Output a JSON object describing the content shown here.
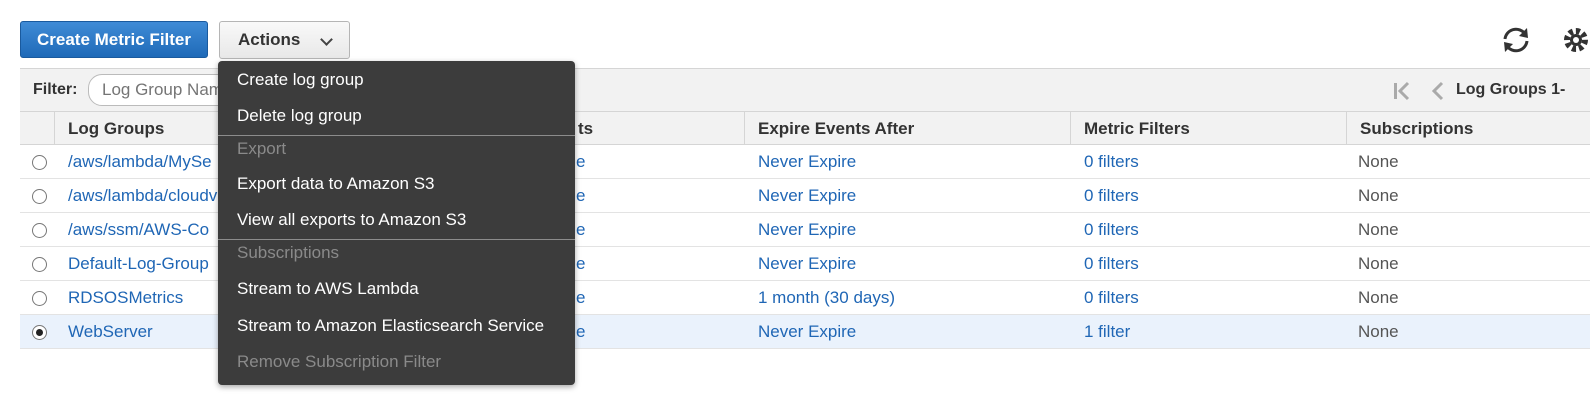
{
  "toolbar": {
    "create_label": "Create Metric Filter",
    "actions_label": "Actions"
  },
  "filter": {
    "label": "Filter:",
    "placeholder": "Log Group Name Prefix",
    "pager_label": "Log Groups 1-"
  },
  "table": {
    "headers": {
      "log_groups": "Log Groups",
      "insights": "ts",
      "expire": "Expire Events After",
      "metric_filters": "Metric Filters",
      "subscriptions": "Subscriptions"
    },
    "rows": [
      {
        "name": "/aws/lambda/MySe",
        "insights": "e",
        "expire": "Never Expire",
        "filters": "0 filters",
        "subscriptions": "None",
        "selected": false
      },
      {
        "name": "/aws/lambda/cloudv",
        "insights": "e",
        "expire": "Never Expire",
        "filters": "0 filters",
        "subscriptions": "None",
        "selected": false
      },
      {
        "name": "/aws/ssm/AWS-Co",
        "insights": "e",
        "expire": "Never Expire",
        "filters": "0 filters",
        "subscriptions": "None",
        "selected": false
      },
      {
        "name": "Default-Log-Group",
        "insights": "e",
        "expire": "Never Expire",
        "filters": "0 filters",
        "subscriptions": "None",
        "selected": false
      },
      {
        "name": "RDSOSMetrics",
        "insights": "e",
        "expire": "1 month (30 days)",
        "filters": "0 filters",
        "subscriptions": "None",
        "selected": false
      },
      {
        "name": "WebServer",
        "insights": "e",
        "expire": "Never Expire",
        "filters": "1 filter",
        "subscriptions": "None",
        "selected": true
      }
    ]
  },
  "menu": {
    "create_log_group": "Create log group",
    "delete_log_group": "Delete log group",
    "export_header": "Export",
    "export_s3": "Export data to Amazon S3",
    "view_exports": "View all exports to Amazon S3",
    "subscriptions_header": "Subscriptions",
    "stream_lambda": "Stream to AWS Lambda",
    "stream_es": "Stream to Amazon Elasticsearch Service",
    "remove_subscription": "Remove Subscription Filter"
  },
  "icons": {
    "refresh": "refresh-icon",
    "settings": "gear-icon",
    "first_page": "first-page-icon",
    "prev_page": "prev-page-icon"
  },
  "colors": {
    "primary": "#1f6ab8",
    "link": "#1f66b5",
    "menu_bg": "#3c3c3c",
    "selected_row": "#eaf2fc"
  }
}
